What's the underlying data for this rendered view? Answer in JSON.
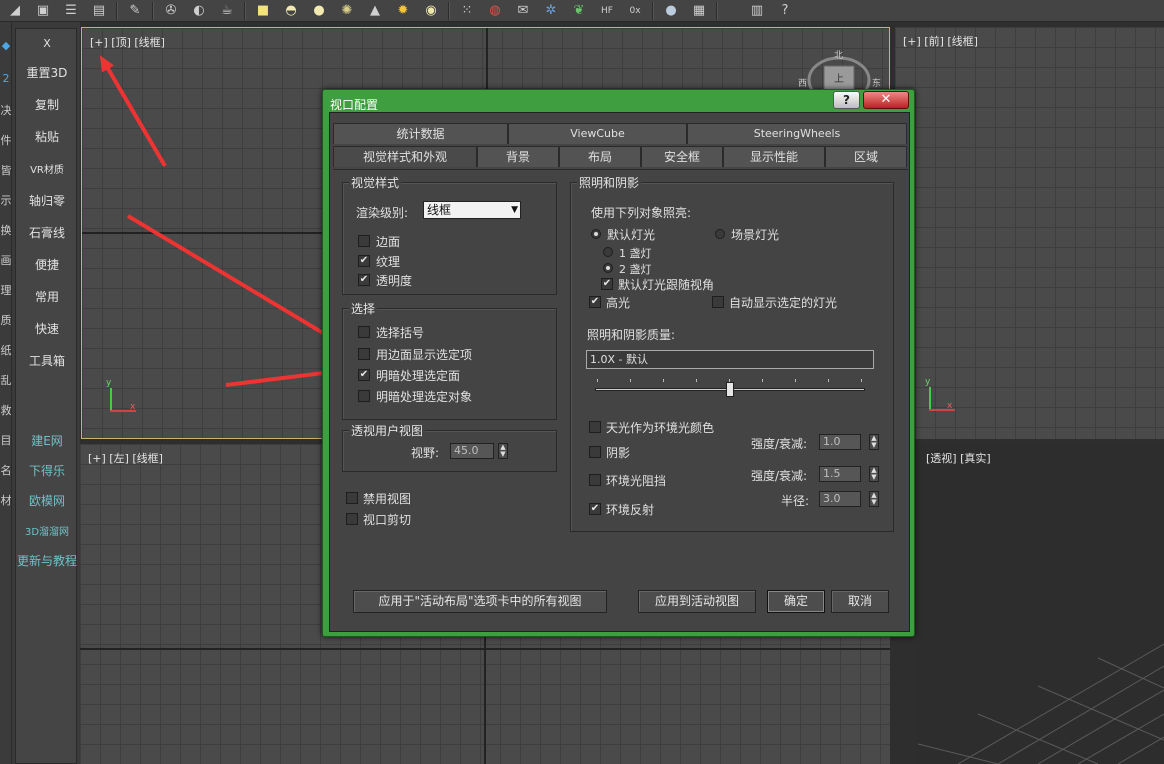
{
  "toolbar": {
    "icons": [
      "shape-icon",
      "render-icon",
      "list-icon",
      "layer-icon",
      "bulb-icon",
      "camera-icon",
      "mirror-icon",
      "teapot-icon",
      "box-icon",
      "dome-icon",
      "sphere-icon",
      "mesh-icon",
      "cone-icon",
      "sun-icon",
      "circle-icon",
      "dots-icon",
      "pill-icon",
      "envelope-icon",
      "gear-icon",
      "grass-icon",
      "hf-icon",
      "ox-icon",
      "ball-icon",
      "screen-icon",
      "panel-icon",
      "help-icon"
    ],
    "hf_label": "HF",
    "ox_label": "0x"
  },
  "left_strip": [
    "2",
    "决",
    "件",
    "皆",
    "示",
    "换",
    "画",
    "理",
    "质",
    "纸",
    "乱",
    "救",
    "目",
    "名",
    "材"
  ],
  "side_panel": {
    "close": "X",
    "items": [
      "重置3D",
      "复制",
      "粘贴",
      "VR材质",
      "轴归零",
      "石膏线",
      "便捷",
      "常用",
      "快速",
      "工具箱"
    ],
    "links": [
      "建E网",
      "下得乐",
      "欧模网",
      "3D溜溜网",
      "更新与教程"
    ]
  },
  "viewports": {
    "top_label": "[+] [顶] [线框]",
    "front_label": "[+] [前] [线框]",
    "left_label": "[+] [左] [线框]",
    "persp_label": "[透视] [真实]",
    "compass_north": "北",
    "compass_west": "西",
    "compass_east": "东",
    "compass_face": "上",
    "axis_x": "x",
    "axis_y": "y"
  },
  "dialog": {
    "title": "视口配置",
    "help": "?",
    "close": "✕",
    "tabs_row1": [
      "统计数据",
      "ViewCube",
      "SteeringWheels"
    ],
    "tabs_row2": [
      "视觉样式和外观",
      "背景",
      "布局",
      "安全框",
      "显示性能",
      "区域"
    ],
    "visual_style": {
      "title": "视觉样式",
      "render_level_label": "渲染级别:",
      "render_level_value": "线框",
      "options": [
        {
          "label": "边面",
          "checked": false
        },
        {
          "label": "纹理",
          "checked": true
        },
        {
          "label": "透明度",
          "checked": true
        }
      ]
    },
    "selection": {
      "title": "选择",
      "options": [
        {
          "label": "选择括号",
          "checked": false
        },
        {
          "label": "用边面显示选定项",
          "checked": false
        },
        {
          "label": "明暗处理选定面",
          "checked": true
        },
        {
          "label": "明暗处理选定对象",
          "checked": false
        }
      ]
    },
    "perspective": {
      "title": "透视用户视图",
      "fov_label": "视野:",
      "fov_value": "45.0"
    },
    "disable_view": "禁用视图",
    "viewport_clip": "视口剪切",
    "lighting": {
      "title": "照明和阴影",
      "use_label": "使用下列对象照亮:",
      "default_lights": "默认灯光",
      "scene_lights": "场景灯光",
      "one_light": "1 盏灯",
      "two_lights": "2 盏灯",
      "follow_view": "默认灯光跟随视角",
      "highlight": "高光",
      "auto_show": "自动显示选定的灯光",
      "quality_label": "照明和阴影质量:",
      "quality_value": "1.0X - 默认",
      "slider_level": 0.5,
      "skylight": "天光作为环境光颜色",
      "shadows": "阴影",
      "ao": "环境光阻挡",
      "reflection": "环境反射",
      "intensity_label": "强度/衰减:",
      "intensity_value": "1.0",
      "ao_intensity_label": "强度/衰减:",
      "ao_intensity_value": "1.5",
      "radius_label": "半径:",
      "radius_value": "3.0"
    },
    "buttons": {
      "apply_all": "应用于\"活动布局\"选项卡中的所有视图",
      "apply_active": "应用到活动视图",
      "ok": "确定",
      "cancel": "取消"
    }
  }
}
